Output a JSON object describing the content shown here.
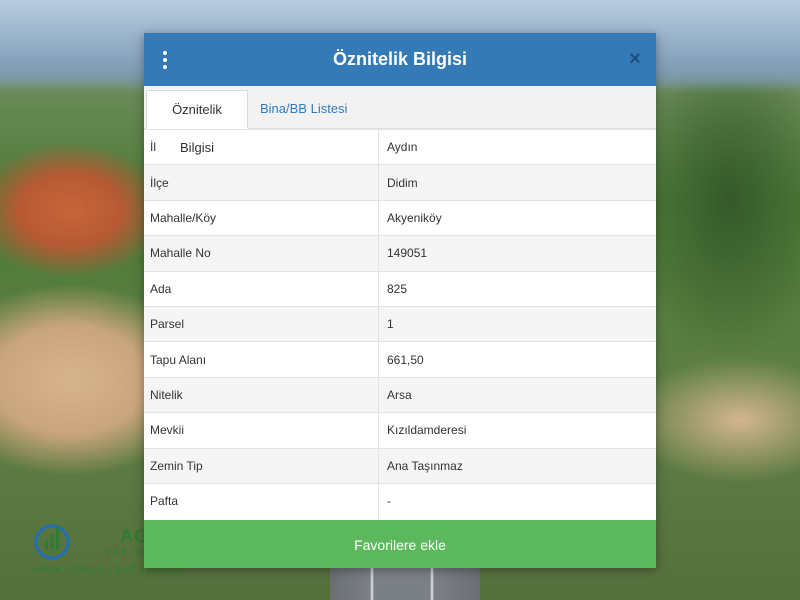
{
  "modal": {
    "title": "Öznitelik Bilgisi",
    "menu_icon": "vertical-dots-icon",
    "close_icon": "close-icon",
    "close_glyph": "×"
  },
  "tabs": [
    {
      "label": "Öznitelik Bilgisi",
      "active": true
    },
    {
      "label": "Bina/BB Listesi",
      "active": false
    }
  ],
  "attributes": [
    {
      "key": "İl",
      "value": "Aydın"
    },
    {
      "key": "İlçe",
      "value": "Didim"
    },
    {
      "key": "Mahalle/Köy",
      "value": "Akyeniköy"
    },
    {
      "key": "Mahalle No",
      "value": "149051"
    },
    {
      "key": "Ada",
      "value": "825"
    },
    {
      "key": "Parsel",
      "value": "1"
    },
    {
      "key": "Tapu Alanı",
      "value": "661,50"
    },
    {
      "key": "Nitelik",
      "value": "Arsa"
    },
    {
      "key": "Mevkii",
      "value": "Kızıldamderesi"
    },
    {
      "key": "Zemin Tip",
      "value": "Ana Taşınmaz"
    },
    {
      "key": "Pafta",
      "value": "-"
    }
  ],
  "actions": {
    "favorite_label": "Favorilere ekle"
  },
  "watermark": {
    "name": "AGD",
    "sub": "YATIRI",
    "tagline": "ARSA | TARLA | BAĞ | BAHÇE"
  },
  "colors": {
    "header": "#337ab7",
    "button": "#5cb85c",
    "link": "#337ab7"
  }
}
